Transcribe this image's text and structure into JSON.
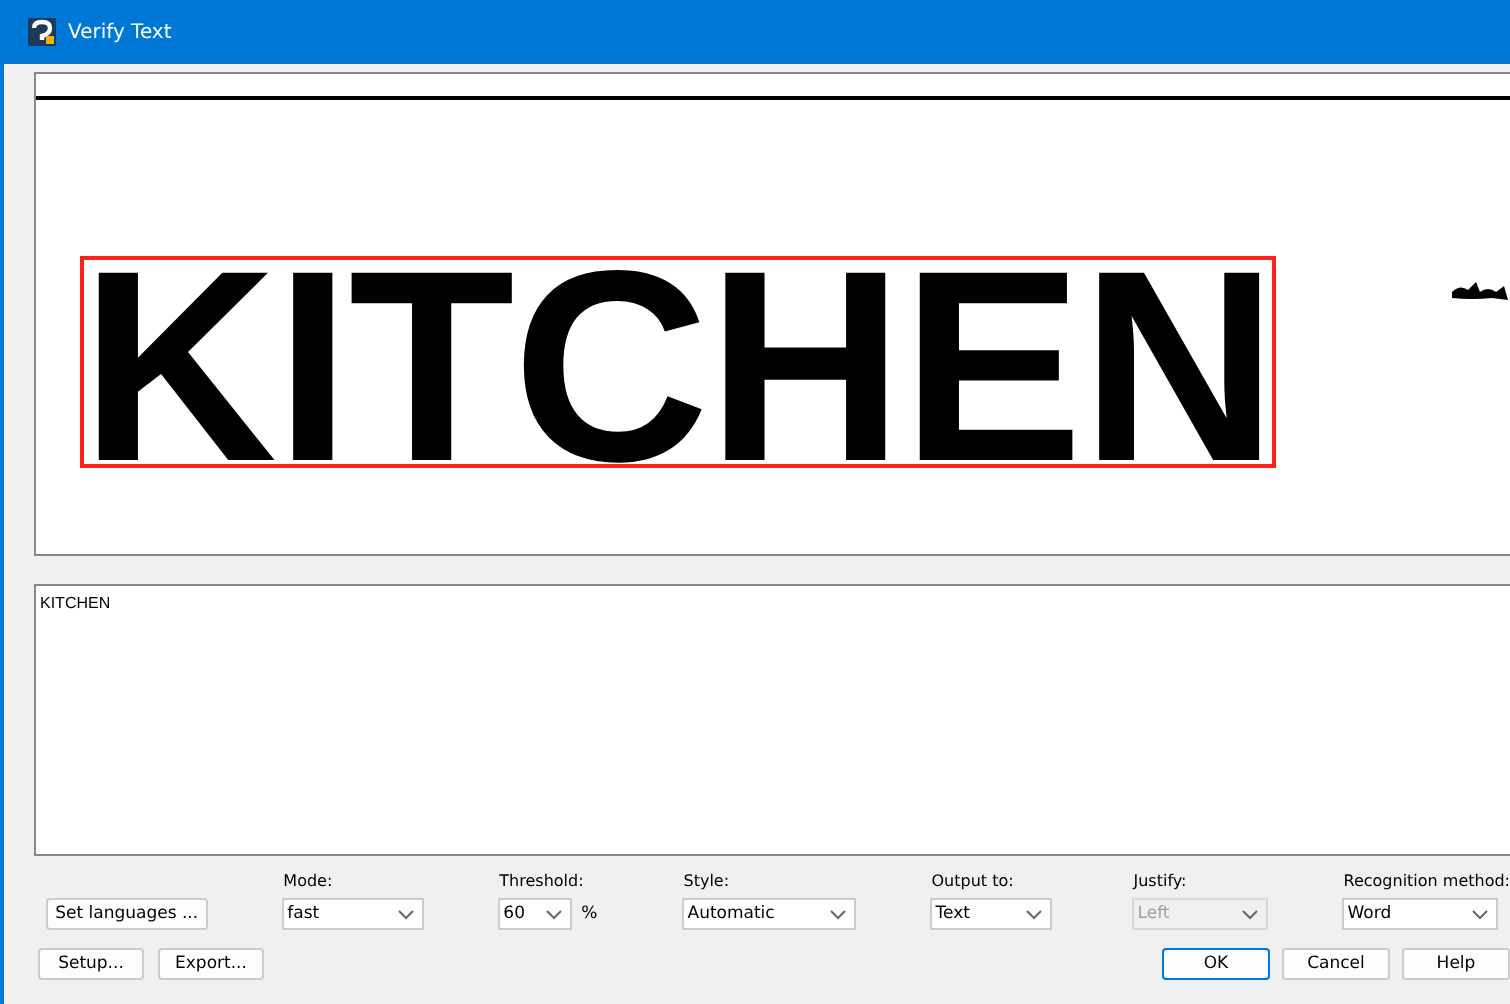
{
  "window": {
    "title": "Verify Text"
  },
  "preview": {
    "word": "KITCHEN",
    "highlighted": true
  },
  "recognized_text": "KITCHEN",
  "left_buttons": [
    "Set languages ..."
  ],
  "options": [
    {
      "label": "Mode:",
      "value": "fast",
      "disabled": false
    },
    {
      "label": "Threshold:",
      "value": "60",
      "unit": "%",
      "disabled": false
    },
    {
      "label": "Style:",
      "value": "Automatic",
      "disabled": false
    },
    {
      "label": "Output to:",
      "value": "Text",
      "disabled": false
    },
    {
      "label": "Justify:",
      "value": "Left",
      "disabled": true
    },
    {
      "label": "Recognition method:",
      "value": "Word",
      "disabled": false
    }
  ],
  "bottom_left_buttons": [
    "Setup...",
    "Export..."
  ],
  "bottom_right_buttons": [
    {
      "label": "OK",
      "default": true
    },
    {
      "label": "Cancel",
      "default": false
    },
    {
      "label": "Help",
      "default": false
    }
  ]
}
